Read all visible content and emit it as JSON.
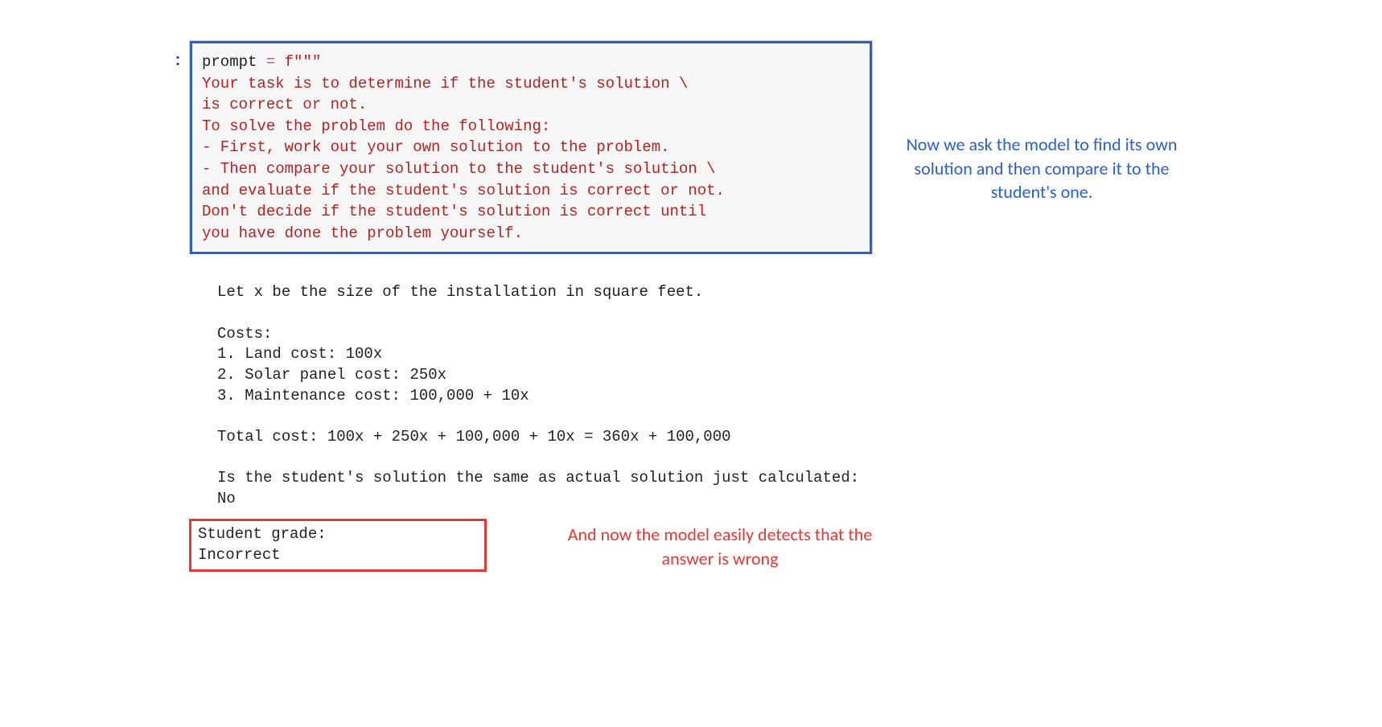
{
  "prompt_indicator": ":",
  "code": {
    "var_name": "prompt ",
    "operator": "= ",
    "fstring_open": "f\"\"\"",
    "line1": "Your task is to determine if the student's solution \\",
    "line2": "is correct or not.",
    "line3": "To solve the problem do the following:",
    "line4": "- First, work out your own solution to the problem.",
    "line5": "- Then compare your solution to the student's solution \\",
    "line6": "and evaluate if the student's solution is correct or not.",
    "line7": "Don't decide if the student's solution is correct until",
    "line8": "you have done the problem yourself."
  },
  "output": {
    "block1": "Let x be the size of the installation in square feet.\n\nCosts:\n1. Land cost: 100x\n2. Solar panel cost: 250x\n3. Maintenance cost: 100,000 + 10x\n\nTotal cost: 100x + 250x + 100,000 + 10x = 360x + 100,000\n\nIs the student's solution the same as actual solution just calculated:\nNo",
    "grade_block": "Student grade:\nIncorrect"
  },
  "annotations": {
    "blue": "Now we ask the model to find its own solution and then compare it to the student's one.",
    "red": "And now the model easily detects that the answer is wrong"
  }
}
